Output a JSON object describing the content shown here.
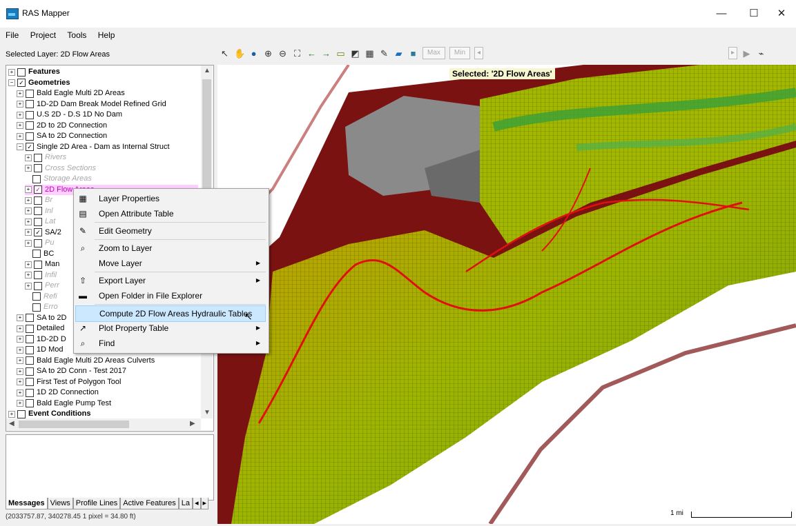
{
  "window": {
    "title": "RAS Mapper",
    "minimize": "—",
    "maximize": "☐",
    "close": "✕"
  },
  "menu": [
    "File",
    "Project",
    "Tools",
    "Help"
  ],
  "toolbar": {
    "selected_layer": "Selected Layer: 2D Flow Areas",
    "max_label": "Max",
    "min_label": "Min"
  },
  "tree": [
    {
      "label": "Features",
      "indent": 0,
      "exp": "+",
      "checked": false,
      "style": "bold"
    },
    {
      "label": "Geometries",
      "indent": 0,
      "exp": "−",
      "checked": true,
      "style": "bold"
    },
    {
      "label": "Bald Eagle Multi 2D Areas",
      "indent": 1,
      "exp": "+",
      "checked": false,
      "style": ""
    },
    {
      "label": "1D-2D Dam Break Model Refined Grid",
      "indent": 1,
      "exp": "+",
      "checked": false,
      "style": ""
    },
    {
      "label": "U.S 2D - D.S 1D No Dam",
      "indent": 1,
      "exp": "+",
      "checked": false,
      "style": ""
    },
    {
      "label": "2D to 2D Connection",
      "indent": 1,
      "exp": "+",
      "checked": false,
      "style": ""
    },
    {
      "label": "SA to 2D Connection",
      "indent": 1,
      "exp": "+",
      "checked": false,
      "style": ""
    },
    {
      "label": "Single 2D Area - Dam as Internal Struct",
      "indent": 1,
      "exp": "−",
      "checked": true,
      "style": ""
    },
    {
      "label": "Rivers",
      "indent": 2,
      "exp": "+",
      "checked": false,
      "style": "gray"
    },
    {
      "label": "Cross Sections",
      "indent": 2,
      "exp": "+",
      "checked": false,
      "style": "gray"
    },
    {
      "label": "Storage Areas",
      "indent": 2,
      "exp": "",
      "checked": false,
      "style": "gray"
    },
    {
      "label": "2D Flow Areas",
      "indent": 2,
      "exp": "+",
      "checked": true,
      "style": "highlight"
    },
    {
      "label": "Br",
      "indent": 2,
      "exp": "+",
      "checked": false,
      "style": "gray"
    },
    {
      "label": "Inl",
      "indent": 2,
      "exp": "+",
      "checked": false,
      "style": "gray"
    },
    {
      "label": "Lat",
      "indent": 2,
      "exp": "+",
      "checked": false,
      "style": "gray"
    },
    {
      "label": "SA/2",
      "indent": 2,
      "exp": "+",
      "checked": true,
      "style": ""
    },
    {
      "label": "Pu",
      "indent": 2,
      "exp": "+",
      "checked": false,
      "style": "gray"
    },
    {
      "label": "BC",
      "indent": 2,
      "exp": "",
      "checked": false,
      "style": ""
    },
    {
      "label": "Man",
      "indent": 2,
      "exp": "+",
      "checked": false,
      "style": ""
    },
    {
      "label": "Infil",
      "indent": 2,
      "exp": "+",
      "checked": false,
      "style": "gray"
    },
    {
      "label": "Perr",
      "indent": 2,
      "exp": "+",
      "checked": false,
      "style": "gray"
    },
    {
      "label": "Refi",
      "indent": 2,
      "exp": "",
      "checked": false,
      "style": "gray"
    },
    {
      "label": "Erro",
      "indent": 2,
      "exp": "",
      "checked": false,
      "style": "gray"
    },
    {
      "label": "SA to 2D",
      "indent": 1,
      "exp": "+",
      "checked": false,
      "style": ""
    },
    {
      "label": "Detailed",
      "indent": 1,
      "exp": "+",
      "checked": false,
      "style": ""
    },
    {
      "label": "1D-2D D",
      "indent": 1,
      "exp": "+",
      "checked": false,
      "style": ""
    },
    {
      "label": "1D Mod",
      "indent": 1,
      "exp": "+",
      "checked": false,
      "style": ""
    },
    {
      "label": "Bald Eagle Multi 2D Areas Culverts",
      "indent": 1,
      "exp": "+",
      "checked": false,
      "style": ""
    },
    {
      "label": "SA to 2D Conn - Test 2017",
      "indent": 1,
      "exp": "+",
      "checked": false,
      "style": ""
    },
    {
      "label": "First Test of Polygon Tool",
      "indent": 1,
      "exp": "+",
      "checked": false,
      "style": ""
    },
    {
      "label": "1D 2D Connection",
      "indent": 1,
      "exp": "+",
      "checked": false,
      "style": ""
    },
    {
      "label": "Bald Eagle Pump Test",
      "indent": 1,
      "exp": "+",
      "checked": false,
      "style": ""
    },
    {
      "label": "Event Conditions",
      "indent": 0,
      "exp": "+",
      "checked": false,
      "style": "bold"
    }
  ],
  "tabs": [
    "Messages",
    "Views",
    "Profile Lines",
    "Active Features",
    "La"
  ],
  "status": "(2033757.87, 340278.45  1 pixel = 34.80 ft)",
  "map": {
    "selected_label": "Selected: '2D Flow Areas'",
    "scale_label": "1 mi"
  },
  "context_menu": {
    "items": [
      {
        "label": "Layer Properties",
        "icon": "layer-properties-icon",
        "glyph": "▦",
        "submenu": false,
        "sep_before": false
      },
      {
        "label": "Open Attribute Table",
        "icon": "attribute-table-icon",
        "glyph": "▤",
        "submenu": false,
        "sep_before": false
      },
      {
        "label": "Edit Geometry",
        "icon": "pencil-icon",
        "glyph": "✎",
        "submenu": false,
        "sep_before": true
      },
      {
        "label": "Zoom to Layer",
        "icon": "zoom-icon",
        "glyph": "⌕",
        "submenu": false,
        "sep_before": true
      },
      {
        "label": "Move Layer",
        "icon": "",
        "glyph": "",
        "submenu": true,
        "sep_before": false
      },
      {
        "label": "Export Layer",
        "icon": "export-icon",
        "glyph": "⇧",
        "submenu": true,
        "sep_before": true
      },
      {
        "label": "Open Folder in File Explorer",
        "icon": "folder-icon",
        "glyph": "▬",
        "submenu": false,
        "sep_before": false
      },
      {
        "label": "Compute 2D Flow Areas Hydraulic Tables",
        "icon": "",
        "glyph": "",
        "submenu": false,
        "sep_before": true,
        "hover": true
      },
      {
        "label": "Plot Property Table",
        "icon": "plot-icon",
        "glyph": "↗",
        "submenu": true,
        "sep_before": false
      },
      {
        "label": "Find",
        "icon": "find-icon",
        "glyph": "⌕",
        "submenu": true,
        "sep_before": false
      }
    ]
  },
  "colors": {
    "accent": "#1b7bbd",
    "highlight": "#ffd0ff",
    "hover": "#cce8ff"
  }
}
